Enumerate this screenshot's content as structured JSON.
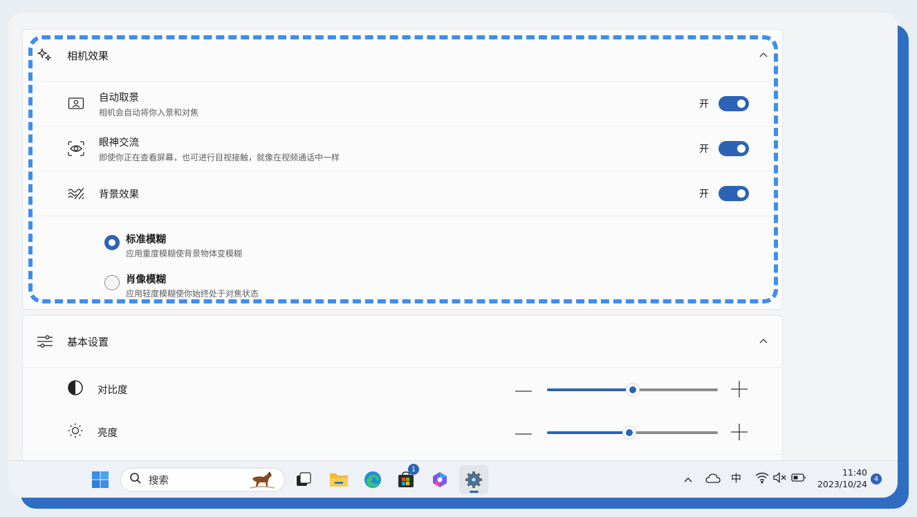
{
  "camera_effects": {
    "title": "相机效果",
    "items": [
      {
        "title": "自动取景",
        "subtitle": "相机会自动将你入景和对焦",
        "state_label": "开",
        "on": true
      },
      {
        "title": "眼神交流",
        "subtitle": "即使你正在查看屏幕，也可进行目视接触，就像在视频通话中一样",
        "state_label": "开",
        "on": true
      },
      {
        "title": "背景效果",
        "subtitle": "",
        "state_label": "开",
        "on": true
      }
    ],
    "background_options": [
      {
        "title": "标准模糊",
        "subtitle": "应用重度模糊使背景物体变模糊",
        "selected": true
      },
      {
        "title": "肖像模糊",
        "subtitle": "应用轻度模糊使你始终处于对焦状态",
        "selected": false
      }
    ]
  },
  "basic_settings": {
    "title": "基本设置",
    "sliders": [
      {
        "label": "对比度",
        "value_fraction": 0.5
      },
      {
        "label": "亮度",
        "value_fraction": 0.48
      }
    ]
  },
  "taskbar": {
    "search_placeholder": "搜索",
    "store_badge": "1",
    "ime_label": "中",
    "time": "11:40",
    "date": "2023/10/24",
    "notification_count": "4"
  },
  "colors": {
    "accent": "#2d63b5",
    "highlight_border": "#3d8ef0",
    "frame": "#2f6dc3"
  },
  "icons": [
    "sparkle-icon",
    "chevron-up-icon",
    "auto-framing-icon",
    "eye-contact-icon",
    "background-effects-icon",
    "sliders-icon",
    "contrast-icon",
    "brightness-icon",
    "minus-icon",
    "plus-icon",
    "windows-start-icon",
    "search-icon",
    "horse-icon",
    "task-view-icon",
    "file-explorer-icon",
    "edge-icon",
    "store-icon",
    "copilot-icon",
    "settings-gear-icon",
    "chevron-up-tray-icon",
    "onedrive-cloud-icon",
    "wifi-icon",
    "volume-muted-icon",
    "battery-icon"
  ]
}
